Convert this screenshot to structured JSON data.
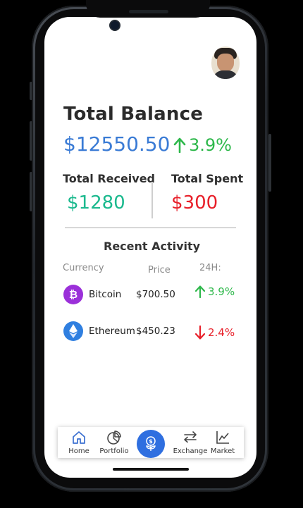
{
  "header": {
    "avatar_icon": "user-avatar"
  },
  "balance": {
    "title": "Total Balance",
    "amount": "$12550.50",
    "change": "3.9%",
    "change_direction": "up"
  },
  "summary": {
    "received_label": "Total Received",
    "received_amount": "$1280",
    "spent_label": "Total Spent",
    "spent_amount": "$300"
  },
  "activity": {
    "title": "Recent Activity",
    "columns": [
      "Currency",
      "Price",
      "24H:"
    ],
    "rows": [
      {
        "name": "Bitcoin",
        "price": "$700.50",
        "change": "3.9%",
        "direction": "up",
        "icon": "bitcoin-icon",
        "icon_color": "#9b30d9"
      },
      {
        "name": "Ethereum",
        "price": "$450.23",
        "change": "2.4%",
        "direction": "down",
        "icon": "ethereum-icon",
        "icon_color": "#2f7fe0"
      }
    ]
  },
  "nav": {
    "items": [
      {
        "label": "Home",
        "icon": "home-icon"
      },
      {
        "label": "Portfolio",
        "icon": "pie-chart-icon"
      },
      {
        "label": "",
        "icon": "dollar-plant-icon"
      },
      {
        "label": "Exchange",
        "icon": "exchange-icon"
      },
      {
        "label": "Market",
        "icon": "line-chart-icon"
      }
    ]
  },
  "colors": {
    "accent_blue": "#3a7bd5",
    "up_green": "#2eb84b",
    "received_teal": "#1bb98e",
    "down_red": "#e8202a"
  }
}
